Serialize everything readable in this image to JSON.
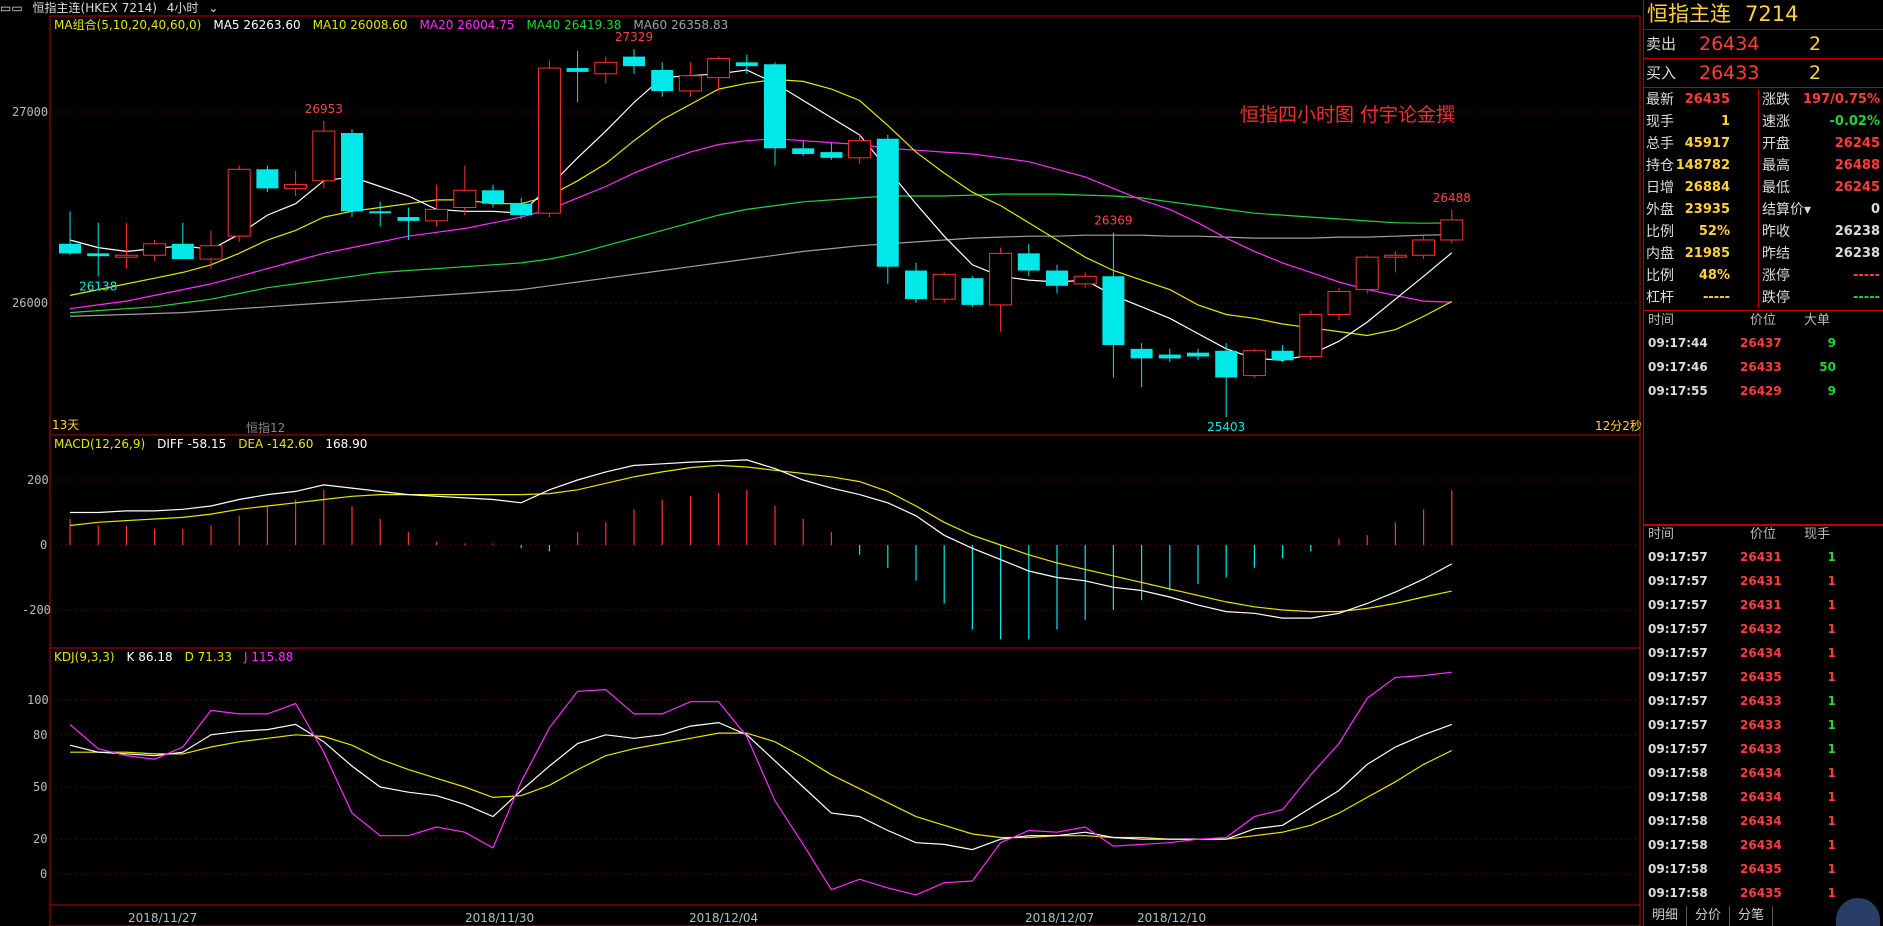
{
  "header": {
    "title": "恒指主连(HKEX 7214)",
    "period": "4小时"
  },
  "ma_legend": [
    {
      "label": "MA组合(5,10,20,40,60,0)",
      "color": "#e6e600"
    },
    {
      "label": "MA5 26263.60",
      "color": "#ffffff"
    },
    {
      "label": "MA10 26008.60",
      "color": "#e6e600"
    },
    {
      "label": "MA20 26004.75",
      "color": "#ff2cff"
    },
    {
      "label": "MA40 26419.38",
      "color": "#22d33a"
    },
    {
      "label": "MA60 26358.83",
      "color": "#a0a0a0"
    }
  ],
  "macd_legend": [
    {
      "label": "MACD(12,26,9)",
      "color": "#e6e600"
    },
    {
      "label": "DIFF -58.15",
      "color": "#ffffff"
    },
    {
      "label": "DEA -142.60",
      "color": "#e6e600"
    },
    {
      "label": "168.90",
      "color": "#ffffff"
    }
  ],
  "kdj_legend": [
    {
      "label": "KDJ(9,3,3)",
      "color": "#e6e600"
    },
    {
      "label": "K 86.18",
      "color": "#ffffff"
    },
    {
      "label": "D 71.33",
      "color": "#e6e600"
    },
    {
      "label": "J 115.88",
      "color": "#ff2cff"
    }
  ],
  "main_labels": {
    "days": "13天",
    "contract": "恒指12",
    "countdown": "12分2秒",
    "note": "恒指四小时图  付宇论金撰"
  },
  "price_axis": [
    "27000",
    "26000"
  ],
  "macd_axis": [
    "200",
    "0",
    "-200"
  ],
  "kdj_axis": [
    "100",
    "80",
    "50",
    "20",
    "0"
  ],
  "dates": [
    "2018/11/27",
    "2018/11/30",
    "2018/12/04",
    "2018/12/07",
    "2018/12/10"
  ],
  "chart_data": {
    "type": "candlestick",
    "candles": [
      {
        "o": 26310,
        "h": 26480,
        "l": 26250,
        "c": 26260,
        "up": false
      },
      {
        "o": 26260,
        "h": 26420,
        "l": 26138,
        "c": 26245,
        "up": false
      },
      {
        "o": 26240,
        "h": 26420,
        "l": 26180,
        "c": 26250,
        "up": true
      },
      {
        "o": 26250,
        "h": 26330,
        "l": 26220,
        "c": 26310,
        "up": true
      },
      {
        "o": 26310,
        "h": 26420,
        "l": 26230,
        "c": 26230,
        "up": false
      },
      {
        "o": 26230,
        "h": 26380,
        "l": 26180,
        "c": 26300,
        "up": true
      },
      {
        "o": 26350,
        "h": 26720,
        "l": 26320,
        "c": 26700,
        "up": true
      },
      {
        "o": 26700,
        "h": 26720,
        "l": 26580,
        "c": 26600,
        "up": false
      },
      {
        "o": 26600,
        "h": 26690,
        "l": 26560,
        "c": 26620,
        "up": true
      },
      {
        "o": 26640,
        "h": 26953,
        "l": 26600,
        "c": 26900,
        "up": true
      },
      {
        "o": 26890,
        "h": 26910,
        "l": 26450,
        "c": 26480,
        "up": false
      },
      {
        "o": 26480,
        "h": 26530,
        "l": 26400,
        "c": 26470,
        "up": false
      },
      {
        "o": 26450,
        "h": 26500,
        "l": 26330,
        "c": 26430,
        "up": false
      },
      {
        "o": 26430,
        "h": 26620,
        "l": 26400,
        "c": 26490,
        "up": true
      },
      {
        "o": 26500,
        "h": 26720,
        "l": 26460,
        "c": 26590,
        "up": true
      },
      {
        "o": 26590,
        "h": 26620,
        "l": 26500,
        "c": 26520,
        "up": false
      },
      {
        "o": 26520,
        "h": 26550,
        "l": 26440,
        "c": 26460,
        "up": false
      },
      {
        "o": 26470,
        "h": 27270,
        "l": 26450,
        "c": 27230,
        "up": true
      },
      {
        "o": 27230,
        "h": 27320,
        "l": 27050,
        "c": 27210,
        "up": false
      },
      {
        "o": 27200,
        "h": 27290,
        "l": 27150,
        "c": 27260,
        "up": true
      },
      {
        "o": 27290,
        "h": 27329,
        "l": 27200,
        "c": 27240,
        "up": false
      },
      {
        "o": 27220,
        "h": 27260,
        "l": 27080,
        "c": 27110,
        "up": false
      },
      {
        "o": 27110,
        "h": 27260,
        "l": 27080,
        "c": 27190,
        "up": true
      },
      {
        "o": 27180,
        "h": 27290,
        "l": 27110,
        "c": 27280,
        "up": true
      },
      {
        "o": 27260,
        "h": 27300,
        "l": 27200,
        "c": 27240,
        "up": false
      },
      {
        "o": 27250,
        "h": 27260,
        "l": 26720,
        "c": 26810,
        "up": false
      },
      {
        "o": 26810,
        "h": 26850,
        "l": 26770,
        "c": 26780,
        "up": false
      },
      {
        "o": 26790,
        "h": 26840,
        "l": 26750,
        "c": 26760,
        "up": false
      },
      {
        "o": 26760,
        "h": 26880,
        "l": 26730,
        "c": 26850,
        "up": true
      },
      {
        "o": 26860,
        "h": 26880,
        "l": 26100,
        "c": 26190,
        "up": false
      },
      {
        "o": 26170,
        "h": 26210,
        "l": 26000,
        "c": 26020,
        "up": false
      },
      {
        "o": 26020,
        "h": 26160,
        "l": 26000,
        "c": 26150,
        "up": true
      },
      {
        "o": 26130,
        "h": 26140,
        "l": 25980,
        "c": 25990,
        "up": false
      },
      {
        "o": 25990,
        "h": 26290,
        "l": 25850,
        "c": 26260,
        "up": true
      },
      {
        "o": 26260,
        "h": 26310,
        "l": 26140,
        "c": 26170,
        "up": false
      },
      {
        "o": 26170,
        "h": 26200,
        "l": 26050,
        "c": 26090,
        "up": false
      },
      {
        "o": 26100,
        "h": 26160,
        "l": 26080,
        "c": 26140,
        "up": true
      },
      {
        "o": 26140,
        "h": 26369,
        "l": 25610,
        "c": 25780,
        "up": false
      },
      {
        "o": 25760,
        "h": 25790,
        "l": 25560,
        "c": 25710,
        "up": false
      },
      {
        "o": 25730,
        "h": 25760,
        "l": 25690,
        "c": 25710,
        "up": false
      },
      {
        "o": 25740,
        "h": 25760,
        "l": 25700,
        "c": 25720,
        "up": false
      },
      {
        "o": 25750,
        "h": 25790,
        "l": 25403,
        "c": 25610,
        "up": false
      },
      {
        "o": 25620,
        "h": 25760,
        "l": 25610,
        "c": 25750,
        "up": true
      },
      {
        "o": 25750,
        "h": 25780,
        "l": 25690,
        "c": 25700,
        "up": false
      },
      {
        "o": 25720,
        "h": 25960,
        "l": 25700,
        "c": 25940,
        "up": true
      },
      {
        "o": 25940,
        "h": 26080,
        "l": 25910,
        "c": 26060,
        "up": true
      },
      {
        "o": 26070,
        "h": 26250,
        "l": 26050,
        "c": 26240,
        "up": true
      },
      {
        "o": 26240,
        "h": 26270,
        "l": 26160,
        "c": 26250,
        "up": true
      },
      {
        "o": 26250,
        "h": 26360,
        "l": 26230,
        "c": 26330,
        "up": true
      },
      {
        "o": 26330,
        "h": 26488,
        "l": 26310,
        "c": 26435,
        "up": true
      }
    ],
    "ma5": [
      26330,
      26290,
      26270,
      26285,
      26300,
      26280,
      26360,
      26460,
      26520,
      26640,
      26660,
      26610,
      26560,
      26490,
      26480,
      26480,
      26470,
      26610,
      26760,
      26900,
      27050,
      27180,
      27190,
      27200,
      27220,
      27150,
      27060,
      26970,
      26880,
      26700,
      26520,
      26350,
      26200,
      26140,
      26120,
      26110,
      26120,
      26040,
      25980,
      25920,
      25840,
      25760,
      25710,
      25700,
      25730,
      25800,
      25900,
      26020,
      26140,
      26263
    ],
    "ma10": [
      26040,
      26070,
      26100,
      26130,
      26160,
      26200,
      26260,
      26330,
      26380,
      26450,
      26480,
      26500,
      26520,
      26540,
      26540,
      26520,
      26520,
      26560,
      26640,
      26730,
      26850,
      26960,
      27040,
      27120,
      27150,
      27170,
      27160,
      27120,
      27060,
      26930,
      26790,
      26680,
      26580,
      26510,
      26420,
      26330,
      26240,
      26170,
      26120,
      26070,
      25990,
      25940,
      25920,
      25890,
      25870,
      25850,
      25830,
      25860,
      25930,
      26008
    ],
    "ma20": [
      25970,
      25990,
      26010,
      26040,
      26070,
      26100,
      26140,
      26180,
      26220,
      26260,
      26290,
      26320,
      26350,
      26370,
      26390,
      26420,
      26450,
      26490,
      26550,
      26610,
      26680,
      26740,
      26790,
      26830,
      26850,
      26860,
      26850,
      26840,
      26830,
      26810,
      26800,
      26790,
      26780,
      26760,
      26740,
      26700,
      26660,
      26600,
      26540,
      26490,
      26420,
      26340,
      26270,
      26210,
      26160,
      26110,
      26070,
      26040,
      26010,
      26004
    ],
    "ma40": [
      25950,
      25960,
      25970,
      25980,
      26000,
      26020,
      26050,
      26080,
      26100,
      26120,
      26140,
      26160,
      26170,
      26180,
      26190,
      26200,
      26210,
      26230,
      26260,
      26300,
      26340,
      26380,
      26420,
      26460,
      26490,
      26510,
      26530,
      26540,
      26550,
      26560,
      26560,
      26560,
      26565,
      26570,
      26570,
      26570,
      26565,
      26560,
      26550,
      26530,
      26510,
      26490,
      26470,
      26460,
      26450,
      26440,
      26430,
      26420,
      26418,
      26419
    ],
    "ma60": [
      25930,
      25935,
      25940,
      25945,
      25950,
      25960,
      25970,
      25980,
      25990,
      26000,
      26010,
      26020,
      26030,
      26040,
      26050,
      26060,
      26070,
      26090,
      26110,
      26130,
      26150,
      26170,
      26190,
      26210,
      26230,
      26250,
      26270,
      26285,
      26300,
      26310,
      26320,
      26330,
      26340,
      26345,
      26350,
      26350,
      26355,
      26355,
      26355,
      26350,
      26350,
      26345,
      26340,
      26340,
      26340,
      26345,
      26345,
      26350,
      26355,
      26358
    ],
    "macd_diff": [
      100,
      100,
      105,
      105,
      110,
      120,
      140,
      155,
      165,
      185,
      175,
      165,
      155,
      150,
      145,
      140,
      130,
      170,
      200,
      225,
      245,
      250,
      255,
      258,
      262,
      235,
      200,
      175,
      155,
      130,
      90,
      30,
      -10,
      -45,
      -80,
      -100,
      -110,
      -130,
      -140,
      -160,
      -185,
      -205,
      -210,
      -225,
      -225,
      -210,
      -180,
      -145,
      -105,
      -58
    ],
    "macd_dea": [
      60,
      70,
      75,
      80,
      85,
      95,
      110,
      120,
      130,
      140,
      150,
      155,
      155,
      155,
      155,
      155,
      155,
      158,
      170,
      190,
      210,
      225,
      238,
      245,
      240,
      230,
      220,
      210,
      195,
      165,
      120,
      70,
      30,
      0,
      -30,
      -55,
      -75,
      -95,
      -115,
      -135,
      -155,
      -175,
      -190,
      -200,
      -205,
      -205,
      -195,
      -180,
      -160,
      -142
    ],
    "macd_hist": [
      80,
      60,
      60,
      50,
      50,
      60,
      90,
      120,
      140,
      170,
      120,
      80,
      40,
      10,
      5,
      5,
      -10,
      -20,
      40,
      70,
      110,
      140,
      150,
      160,
      170,
      120,
      80,
      40,
      -30,
      -70,
      -110,
      -180,
      -260,
      -290,
      -290,
      -260,
      -230,
      -200,
      -170,
      -140,
      -120,
      -100,
      -70,
      -40,
      -20,
      20,
      30,
      70,
      110,
      168
    ],
    "k": [
      74,
      70,
      69,
      68,
      70,
      80,
      82,
      83,
      86,
      76,
      62,
      50,
      47,
      45,
      40,
      33,
      48,
      62,
      75,
      80,
      78,
      80,
      85,
      87,
      80,
      65,
      50,
      35,
      33,
      25,
      18,
      17,
      14,
      20,
      22,
      22,
      24,
      21,
      20,
      20,
      20,
      20,
      26,
      28,
      38,
      48,
      63,
      73,
      80,
      86
    ],
    "d": [
      70,
      70,
      70,
      69,
      69,
      73,
      76,
      78,
      80,
      79,
      74,
      66,
      60,
      55,
      50,
      44,
      45,
      51,
      60,
      68,
      72,
      75,
      78,
      81,
      81,
      76,
      67,
      57,
      49,
      41,
      33,
      28,
      23,
      21,
      21,
      22,
      22,
      21,
      21,
      20,
      20,
      20,
      22,
      24,
      28,
      35,
      44,
      53,
      63,
      71
    ],
    "j": [
      86,
      72,
      68,
      66,
      73,
      94,
      92,
      92,
      98,
      70,
      35,
      22,
      22,
      27,
      24,
      15,
      53,
      84,
      105,
      106,
      92,
      92,
      99,
      99,
      79,
      42,
      17,
      -9,
      -3,
      -8,
      -12,
      -5,
      -4,
      18,
      25,
      24,
      27,
      16,
      17,
      18,
      20,
      21,
      33,
      37,
      57,
      75,
      101,
      113,
      114,
      116
    ]
  },
  "quote": {
    "name": "恒指主连",
    "code": "7214",
    "sell": {
      "label": "卖出",
      "price": "26434",
      "vol": "2"
    },
    "buy": {
      "label": "买入",
      "price": "26433",
      "vol": "2"
    },
    "stats": [
      {
        "a": "最新",
        "b": "26435",
        "bc": "red",
        "c": "涨跌",
        "d": "197/0.75%",
        "dc": "red"
      },
      {
        "a": "现手",
        "b": "1",
        "bc": "yellow",
        "c": "速涨",
        "d": "-0.02%",
        "dc": "green"
      },
      {
        "a": "总手",
        "b": "45917",
        "bc": "yellow",
        "c": "开盘",
        "d": "26245",
        "dc": "red"
      },
      {
        "a": "持仓",
        "b": "148782",
        "bc": "yellow",
        "c": "最高",
        "d": "26488",
        "dc": "red"
      },
      {
        "a": "日增",
        "b": "26884",
        "bc": "yellow",
        "c": "最低",
        "d": "26245",
        "dc": "red"
      },
      {
        "a": "外盘",
        "b": "23935",
        "bc": "yellow",
        "c": "结算价▾",
        "d": "0",
        "dc": "white"
      },
      {
        "a": "比例",
        "b": "52%",
        "bc": "yellow",
        "c": "昨收",
        "d": "26238",
        "dc": "white"
      },
      {
        "a": "内盘",
        "b": "21985",
        "bc": "yellow",
        "c": "昨结",
        "d": "26238",
        "dc": "white"
      },
      {
        "a": "比例",
        "b": "48%",
        "bc": "yellow",
        "c": "涨停",
        "d": "-----",
        "dc": "red"
      },
      {
        "a": "杠杆",
        "b": "-----",
        "bc": "yellow",
        "c": "跌停",
        "d": "-----",
        "dc": "green"
      }
    ],
    "big_header": {
      "t": "时间",
      "p": "价位",
      "v": "大单"
    },
    "big_orders": [
      {
        "t": "09:17:44",
        "p": "26437",
        "v": "9",
        "vc": "green"
      },
      {
        "t": "09:17:46",
        "p": "26433",
        "v": "50",
        "vc": "green"
      },
      {
        "t": "09:17:55",
        "p": "26429",
        "v": "9",
        "vc": "green"
      }
    ],
    "tick_header": {
      "t": "时间",
      "p": "价位",
      "v": "现手"
    },
    "ticks": [
      {
        "t": "09:17:57",
        "p": "26431",
        "v": "1",
        "vc": "green"
      },
      {
        "t": "09:17:57",
        "p": "26431",
        "v": "1",
        "vc": "red"
      },
      {
        "t": "09:17:57",
        "p": "26431",
        "v": "1",
        "vc": "red"
      },
      {
        "t": "09:17:57",
        "p": "26432",
        "v": "1",
        "vc": "red"
      },
      {
        "t": "09:17:57",
        "p": "26434",
        "v": "1",
        "vc": "red"
      },
      {
        "t": "09:17:57",
        "p": "26435",
        "v": "1",
        "vc": "red"
      },
      {
        "t": "09:17:57",
        "p": "26433",
        "v": "1",
        "vc": "green"
      },
      {
        "t": "09:17:57",
        "p": "26433",
        "v": "1",
        "vc": "green"
      },
      {
        "t": "09:17:57",
        "p": "26433",
        "v": "1",
        "vc": "green"
      },
      {
        "t": "09:17:58",
        "p": "26434",
        "v": "1",
        "vc": "red"
      },
      {
        "t": "09:17:58",
        "p": "26434",
        "v": "1",
        "vc": "red"
      },
      {
        "t": "09:17:58",
        "p": "26434",
        "v": "1",
        "vc": "red"
      },
      {
        "t": "09:17:58",
        "p": "26434",
        "v": "1",
        "vc": "red"
      },
      {
        "t": "09:17:58",
        "p": "26435",
        "v": "1",
        "vc": "red"
      },
      {
        "t": "09:17:58",
        "p": "26435",
        "v": "1",
        "vc": "red"
      }
    ],
    "tabs": [
      "明细",
      "分价",
      "分笔"
    ]
  }
}
